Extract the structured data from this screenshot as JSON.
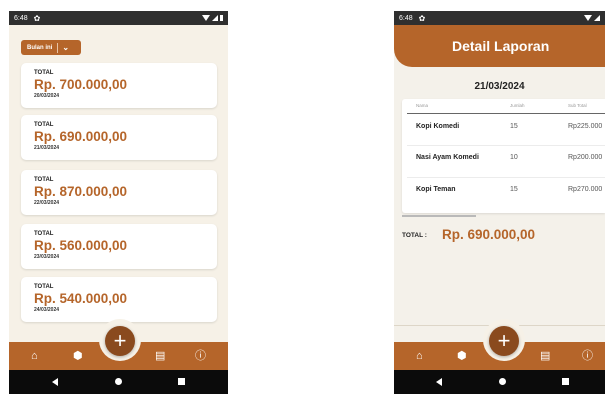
{
  "screen1": {
    "status": {
      "time": "6:48"
    },
    "filter": {
      "label": "Bulan ini"
    },
    "cards": [
      {
        "label": "TOTAL",
        "amount": "Rp. 700.000,00",
        "date": "20/03/2024"
      },
      {
        "label": "TOTAL",
        "amount": "Rp. 690.000,00",
        "date": "21/03/2024"
      },
      {
        "label": "TOTAL",
        "amount": "Rp. 870.000,00",
        "date": "22/03/2024"
      },
      {
        "label": "TOTAL",
        "amount": "Rp. 560.000,00",
        "date": "23/03/2024"
      },
      {
        "label": "TOTAL",
        "amount": "Rp. 540.000,00",
        "date": "24/03/2024"
      }
    ]
  },
  "screen2": {
    "status": {
      "time": "6:48"
    },
    "title": "Detail Laporan",
    "date": "21/03/2024",
    "table": {
      "headers": [
        "Nama",
        "Jumlah",
        "Sub Total"
      ],
      "rows": [
        {
          "nama": "Kopi Komedi",
          "jumlah": "15",
          "subtotal": "Rp225.000"
        },
        {
          "nama": "Nasi Ayam Komedi",
          "jumlah": "10",
          "subtotal": "Rp200.000"
        },
        {
          "nama": "Kopi Teman",
          "jumlah": "15",
          "subtotal": "Rp270.000"
        }
      ]
    },
    "total_label": "TOTAL :",
    "total_amount": "Rp. 690.000,00"
  },
  "icons": {
    "gear": "gear-icon",
    "home": "home-icon",
    "box": "box-icon",
    "add": "plus-icon",
    "clipboard": "clipboard-icon",
    "info": "info-icon"
  },
  "colors": {
    "accent": "#b5652a",
    "fab": "#8a4a1e",
    "background": "#f6f1e7",
    "status_bar": "#2f2f2f",
    "system_nav": "#0b0b0b"
  }
}
